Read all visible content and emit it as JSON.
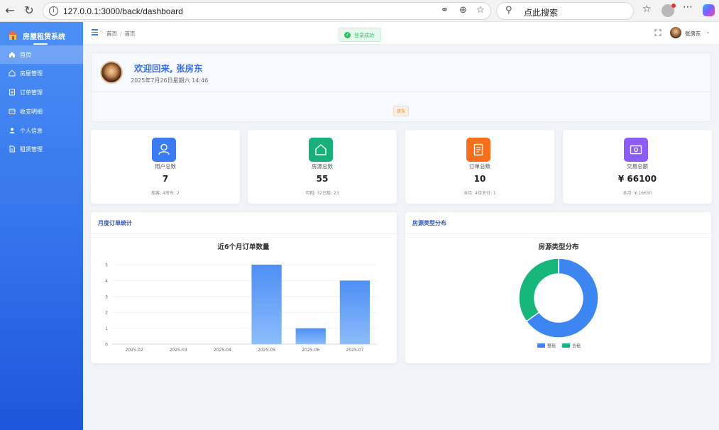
{
  "browser": {
    "url": "127.0.0.1:3000/back/dashboard",
    "search_placeholder": "点此搜索",
    "back_icon": "arrow-left-icon",
    "reload_icon": "reload-icon"
  },
  "sidebar": {
    "brand": "房屋租赁系统",
    "items": [
      {
        "label": "首页",
        "icon": "home-icon",
        "active": true
      },
      {
        "label": "房屋管理",
        "icon": "house-icon",
        "active": false
      },
      {
        "label": "订单管理",
        "icon": "order-icon",
        "active": false
      },
      {
        "label": "收支明细",
        "icon": "wallet-icon",
        "active": false
      },
      {
        "label": "个人信息",
        "icon": "user-icon",
        "active": false
      },
      {
        "label": "租赁管理",
        "icon": "document-icon",
        "active": false
      }
    ]
  },
  "header": {
    "breadcrumb": [
      "首页",
      "首页"
    ],
    "toast": "登录成功",
    "username": "张房东"
  },
  "welcome": {
    "title": "欢迎回来, 张房东",
    "datetime": "2025年7月26日星期六 14:46",
    "role": "房东"
  },
  "stats": [
    {
      "label": "用户总数",
      "value": "7",
      "sub": "租客: 4房东: 2",
      "color": "#3b7bf2",
      "icon": "user-icon"
    },
    {
      "label": "房源总数",
      "value": "55",
      "sub": "可租: 32已租: 23",
      "color": "#18b07a",
      "icon": "house-icon"
    },
    {
      "label": "订单总数",
      "value": "10",
      "sub": "本月: 4待支付: 1",
      "color": "#f56f1c",
      "icon": "order-icon"
    },
    {
      "label": "交易总额",
      "value": "¥ 66100",
      "sub": "本月: ¥ 16650",
      "color": "#8b5cf6",
      "icon": "money-icon"
    }
  ],
  "monthly_card": {
    "title": "月度订单统计"
  },
  "type_card": {
    "title": "房源类型分布"
  },
  "chart_data": [
    {
      "type": "bar",
      "title": "近6个月订单数量",
      "categories": [
        "2025-02",
        "2025-03",
        "2025-04",
        "2025-05",
        "2025-06",
        "2025-07"
      ],
      "values": [
        0,
        0,
        0,
        5,
        1,
        4
      ],
      "ylim": [
        0,
        5
      ],
      "yticks": [
        0,
        1,
        2,
        3,
        4,
        5
      ],
      "grid": true,
      "color": "#4e8ff5"
    },
    {
      "type": "pie",
      "title": "房源类型分布",
      "labels": [
        "整租",
        "合租"
      ],
      "values": [
        65,
        35
      ],
      "colors": [
        "#3d86f2",
        "#17b67b"
      ],
      "legend": "bottom"
    }
  ]
}
